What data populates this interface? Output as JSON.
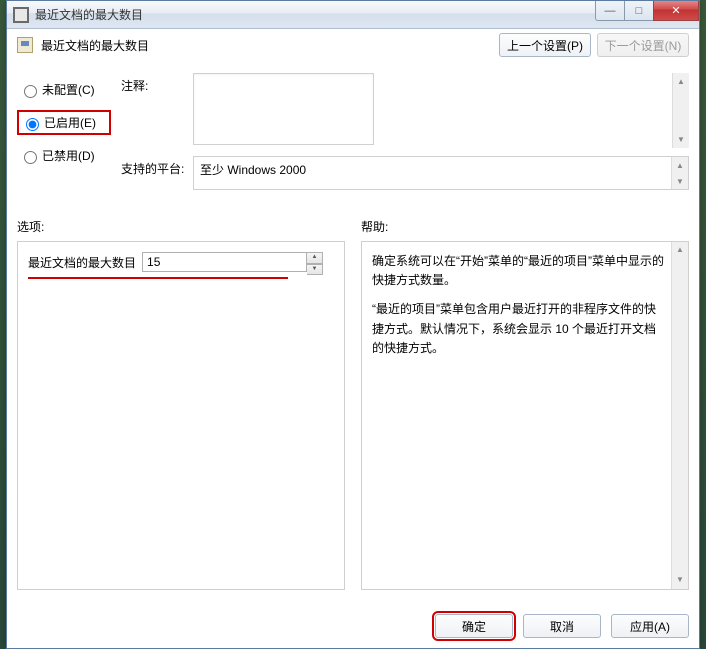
{
  "window": {
    "title": "最近文档的最大数目",
    "min": "—",
    "max": "□",
    "close": "✕"
  },
  "header": {
    "title": "最近文档的最大数目",
    "prev_btn": "上一个设置(P)",
    "next_btn": "下一个设置(N)"
  },
  "radios": {
    "not_configured": "未配置(C)",
    "enabled": "已启用(E)",
    "disabled": "已禁用(D)"
  },
  "fields": {
    "comment_label": "注释:",
    "comment_value": "",
    "platform_label": "支持的平台:",
    "platform_value": "至少 Windows 2000"
  },
  "panes": {
    "options_label": "选项:",
    "help_label": "帮助:"
  },
  "option": {
    "label": "最近文档的最大数目",
    "value": "15"
  },
  "help": {
    "p1": "确定系统可以在“开始”菜单的“最近的项目”菜单中显示的快捷方式数量。",
    "p2": "“最近的项目”菜单包含用户最近打开的非程序文件的快捷方式。默认情况下，系统会显示 10 个最近打开文档的快捷方式。"
  },
  "footer": {
    "ok": "确定",
    "cancel": "取消",
    "apply": "应用(A)"
  }
}
